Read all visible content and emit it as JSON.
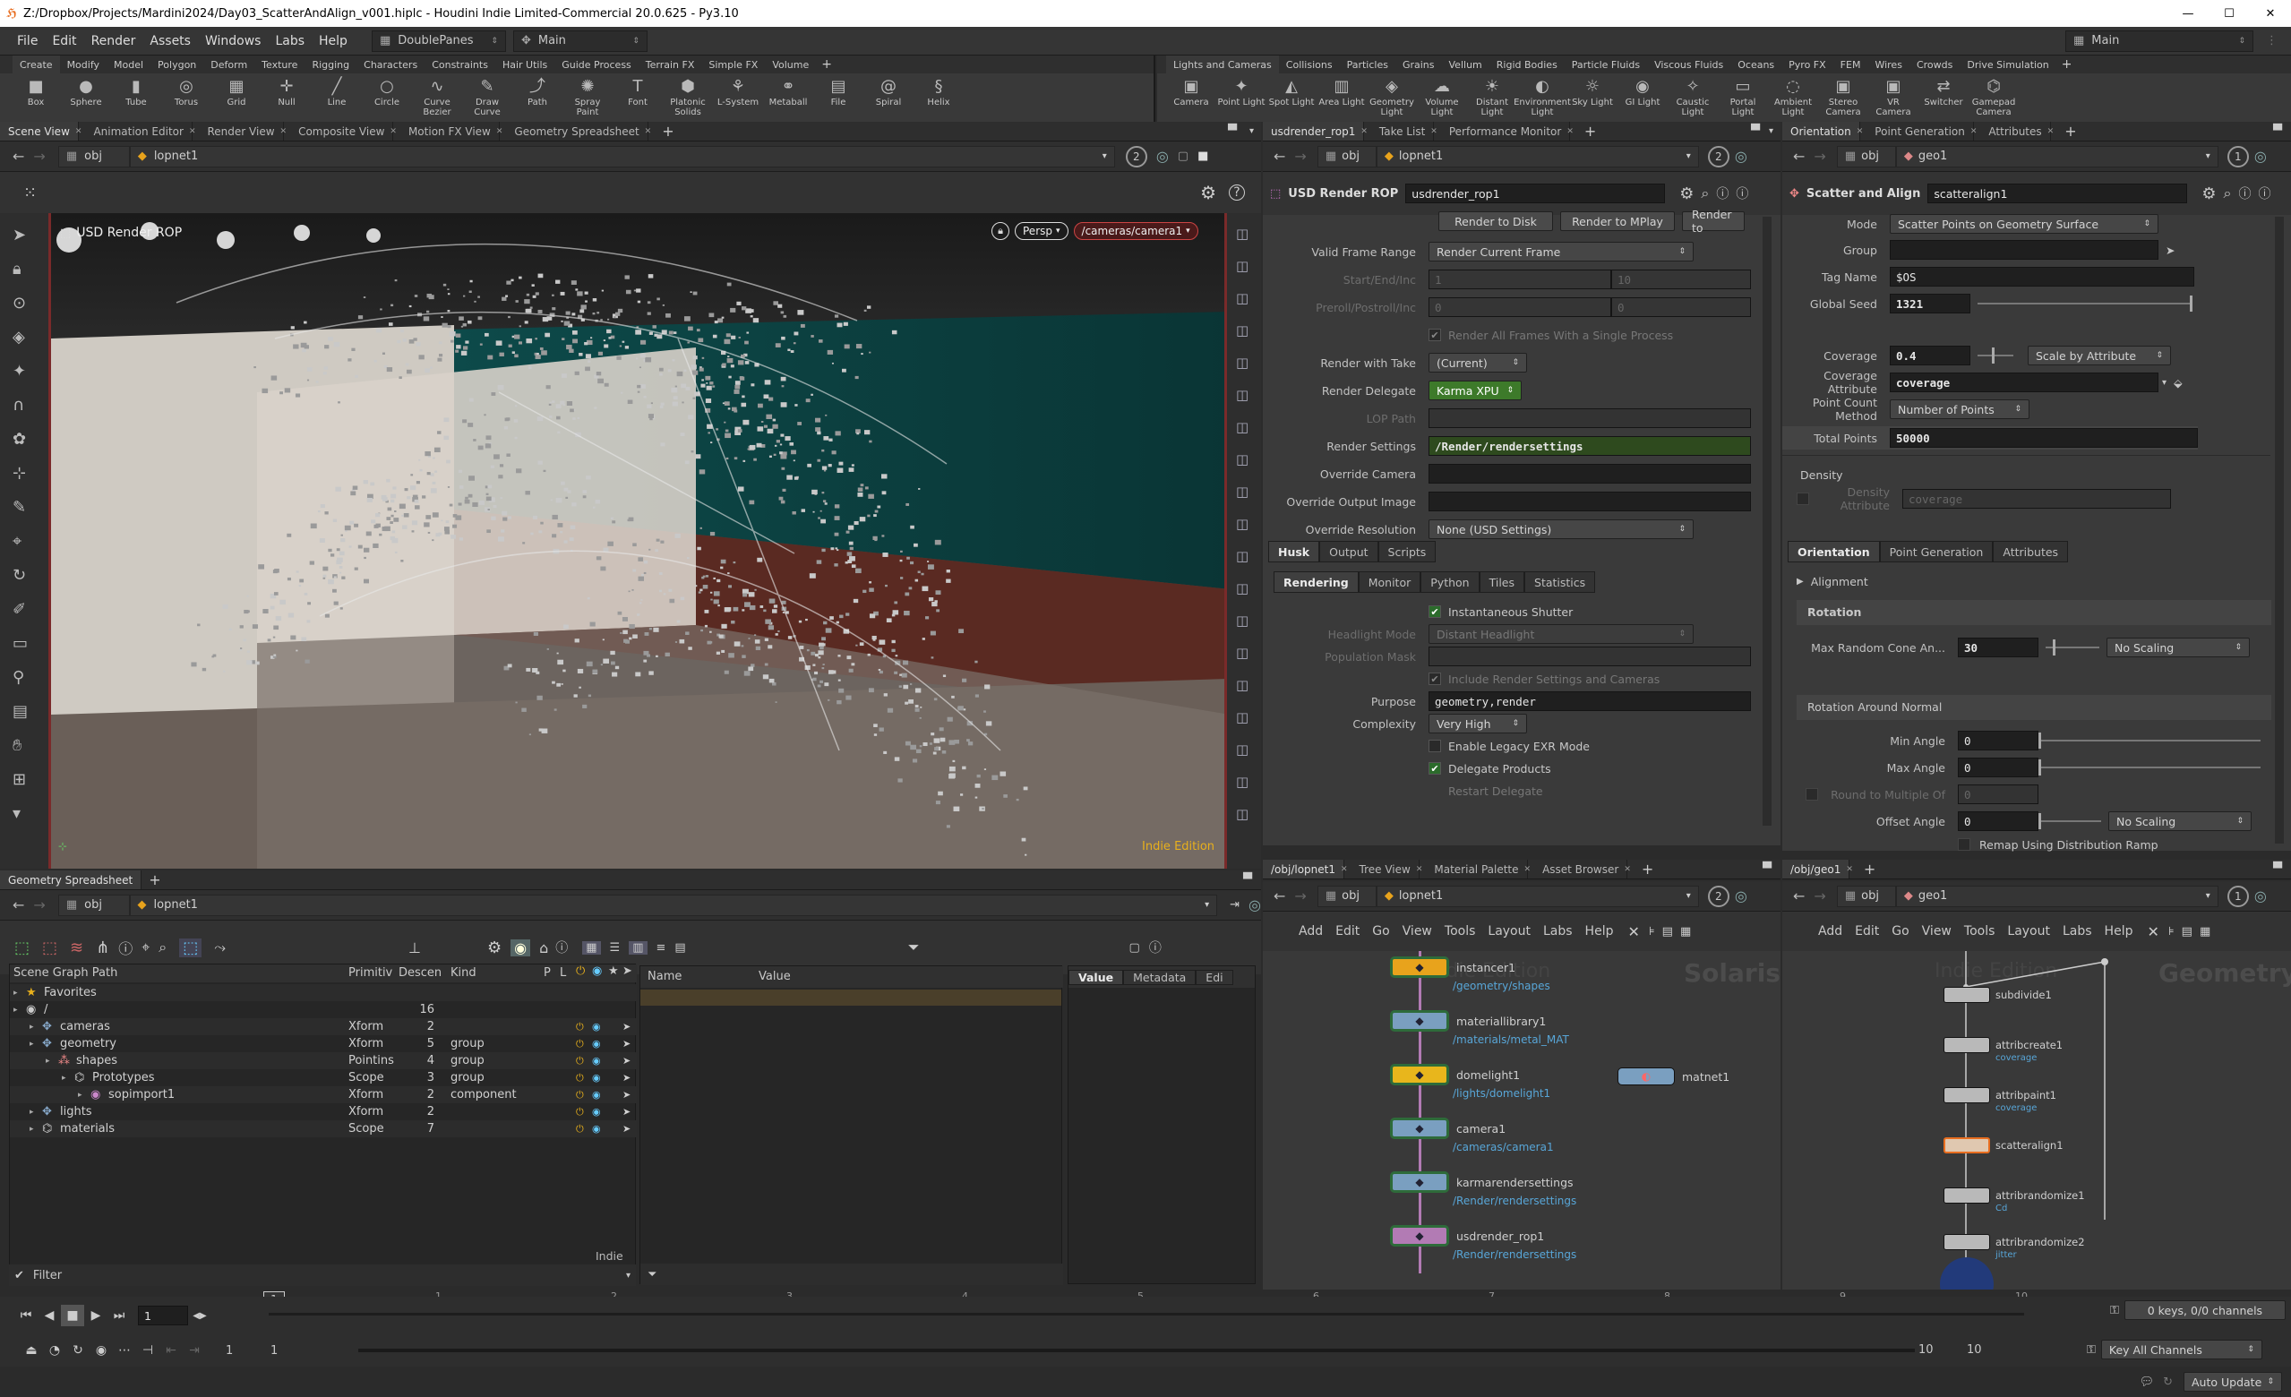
{
  "titlebar": {
    "title": "Z:/Dropbox/Projects/Mardini2024/Day03_ScatterAndAlign_v001.hiplc - Houdini Indie Limited-Commercial 20.0.625 - Py3.10",
    "minimize": "—",
    "maximize": "☐",
    "close": "✕"
  },
  "menubar": {
    "items": [
      "File",
      "Edit",
      "Render",
      "Assets",
      "Windows",
      "Labs",
      "Help"
    ],
    "desktop": "DoublePanes",
    "workspace": "Main",
    "right_workspace": "Main"
  },
  "shelf_left": {
    "tabs": [
      "Create",
      "Modify",
      "Model",
      "Polygon",
      "Deform",
      "Texture",
      "Rigging",
      "Characters",
      "Constraints",
      "Hair Utils",
      "Guide Process",
      "Terrain FX",
      "Simple FX",
      "Volume"
    ],
    "tools": [
      {
        "label": "Box",
        "icon": "box-icon",
        "glyph": "■"
      },
      {
        "label": "Sphere",
        "icon": "sphere-icon",
        "glyph": "●"
      },
      {
        "label": "Tube",
        "icon": "tube-icon",
        "glyph": "▮"
      },
      {
        "label": "Torus",
        "icon": "torus-icon",
        "glyph": "◎"
      },
      {
        "label": "Grid",
        "icon": "grid-icon",
        "glyph": "▦"
      },
      {
        "label": "Null",
        "icon": "null-icon",
        "glyph": "✛"
      },
      {
        "label": "Line",
        "icon": "line-icon",
        "glyph": "╱"
      },
      {
        "label": "Circle",
        "icon": "circle-icon",
        "glyph": "○"
      },
      {
        "label": "Curve Bezier",
        "icon": "curve-bezier-icon",
        "glyph": "∿"
      },
      {
        "label": "Draw Curve",
        "icon": "draw-curve-icon",
        "glyph": "✎"
      },
      {
        "label": "Path",
        "icon": "path-icon",
        "glyph": "⤴"
      },
      {
        "label": "Spray Paint",
        "icon": "spray-paint-icon",
        "glyph": "✺"
      },
      {
        "label": "Font",
        "icon": "font-icon",
        "glyph": "T"
      },
      {
        "label": "Platonic Solids",
        "icon": "platonic-solids-icon",
        "glyph": "⬢"
      },
      {
        "label": "L-System",
        "icon": "l-system-icon",
        "glyph": "⚘"
      },
      {
        "label": "Metaball",
        "icon": "metaball-icon",
        "glyph": "⚭"
      },
      {
        "label": "File",
        "icon": "file-icon",
        "glyph": "▤"
      },
      {
        "label": "Spiral",
        "icon": "spiral-icon",
        "glyph": "@"
      },
      {
        "label": "Helix",
        "icon": "helix-icon",
        "glyph": "§"
      }
    ]
  },
  "shelf_right": {
    "tabs": [
      "Lights and Cameras",
      "Collisions",
      "Particles",
      "Grains",
      "Vellum",
      "Rigid Bodies",
      "Particle Fluids",
      "Viscous Fluids",
      "Oceans",
      "Pyro FX",
      "FEM",
      "Wires",
      "Crowds",
      "Drive Simulation"
    ],
    "tools": [
      {
        "label": "Camera",
        "icon": "camera-icon",
        "glyph": "▣"
      },
      {
        "label": "Point Light",
        "icon": "point-light-icon",
        "glyph": "✦"
      },
      {
        "label": "Spot Light",
        "icon": "spot-light-icon",
        "glyph": "◭"
      },
      {
        "label": "Area Light",
        "icon": "area-light-icon",
        "glyph": "▥"
      },
      {
        "label": "Geometry Light",
        "icon": "geometry-light-icon",
        "glyph": "◈"
      },
      {
        "label": "Volume Light",
        "icon": "volume-light-icon",
        "glyph": "☁"
      },
      {
        "label": "Distant Light",
        "icon": "distant-light-icon",
        "glyph": "☀"
      },
      {
        "label": "Environment Light",
        "icon": "environment-light-icon",
        "glyph": "◐"
      },
      {
        "label": "Sky Light",
        "icon": "sky-light-icon",
        "glyph": "☼"
      },
      {
        "label": "GI Light",
        "icon": "gi-light-icon",
        "glyph": "◉"
      },
      {
        "label": "Caustic Light",
        "icon": "caustic-light-icon",
        "glyph": "✧"
      },
      {
        "label": "Portal Light",
        "icon": "portal-light-icon",
        "glyph": "▭"
      },
      {
        "label": "Ambient Light",
        "icon": "ambient-light-icon",
        "glyph": "◌"
      },
      {
        "label": "Stereo Camera",
        "icon": "stereo-camera-icon",
        "glyph": "▣"
      },
      {
        "label": "VR Camera",
        "icon": "vr-camera-icon",
        "glyph": "▣"
      },
      {
        "label": "Switcher",
        "icon": "switcher-icon",
        "glyph": "⇄"
      },
      {
        "label": "Gamepad Camera",
        "icon": "gamepad-camera-icon",
        "glyph": "⌬"
      }
    ]
  },
  "viewer": {
    "tabs": [
      "Scene View",
      "Animation Editor",
      "Render View",
      "Composite View",
      "Motion FX View",
      "Geometry Spreadsheet"
    ],
    "path": [
      "obj",
      "lopnet1"
    ],
    "badge": "2",
    "overlay_title": "USD Render ROP",
    "persp": "Persp",
    "camera": "/cameras/camera1",
    "watermark": "Indie Edition"
  },
  "rop_panel": {
    "tabs": [
      "usdrender_rop1",
      "Take List",
      "Performance Monitor"
    ],
    "path": [
      "obj",
      "lopnet1"
    ],
    "badge": "2",
    "node_type": "USD Render ROP",
    "node_name": "usdrender_rop1",
    "buttons": [
      "Render to Disk",
      "Render to MPlay",
      "Render to"
    ],
    "parms": [
      {
        "label": "Valid Frame Range",
        "value": "Render Current Frame",
        "kind": "menu"
      },
      {
        "label": "Start/End/Inc",
        "v1": "1",
        "v2": "10",
        "kind": "dim"
      },
      {
        "label": "Preroll/Postroll/Inc",
        "v1": "0",
        "v2": "0",
        "kind": "dim"
      },
      {
        "label": "",
        "value": "Render All Frames With a Single Process",
        "kind": "dimcheck"
      },
      {
        "label": "Render with Take",
        "value": "(Current)",
        "kind": "menu"
      },
      {
        "label": "Render Delegate",
        "value": "Karma XPU",
        "kind": "green"
      },
      {
        "label": "LOP Path",
        "value": "",
        "kind": "dimfield"
      },
      {
        "label": "Render Settings",
        "value": "/Render/rendersettings",
        "kind": "greenfield"
      },
      {
        "label": "Override Camera",
        "value": "",
        "kind": "field"
      },
      {
        "label": "Override Output Image",
        "value": "",
        "kind": "field"
      },
      {
        "label": "Override Resolution",
        "value": "None (USD Settings)",
        "kind": "menu"
      }
    ],
    "tabs1": [
      "Husk",
      "Output",
      "Scripts"
    ],
    "tabs2": [
      "Rendering",
      "Monitor",
      "Python",
      "Tiles",
      "Statistics"
    ],
    "rendering": [
      {
        "label": "",
        "value": "Instantaneous Shutter",
        "kind": "check"
      },
      {
        "label": "Headlight Mode",
        "value": "Distant Headlight",
        "kind": "dimmenu"
      },
      {
        "label": "Population Mask",
        "value": "",
        "kind": "dimfield"
      },
      {
        "label": "",
        "value": "Include Render Settings and Cameras",
        "kind": "dimcheck"
      },
      {
        "label": "Purpose",
        "value": "geometry,render",
        "kind": "field"
      },
      {
        "label": "Complexity",
        "value": "Very High",
        "kind": "menu"
      },
      {
        "label": "",
        "value": "Enable Legacy EXR Mode",
        "kind": "uncheck"
      },
      {
        "label": "",
        "value": "Delegate Products",
        "kind": "check"
      },
      {
        "label": "",
        "value": "Restart Delegate",
        "kind": "dimtext"
      }
    ]
  },
  "scatter_panel": {
    "tabs": [
      "Orientation",
      "Point Generation",
      "Attributes"
    ],
    "path": [
      "obj",
      "geo1"
    ],
    "badge": "1",
    "node_type": "Scatter and Align",
    "node_name": "scatteralign1",
    "mode": {
      "label": "Mode",
      "value": "Scatter Points on Geometry Surface"
    },
    "group": {
      "label": "Group",
      "value": ""
    },
    "tag": {
      "label": "Tag Name",
      "value": "$OS"
    },
    "seed": {
      "label": "Global Seed",
      "value": "1321"
    },
    "coverage": {
      "label": "Coverage",
      "value": "0.4",
      "button": "Scale by Attribute"
    },
    "cov_attr": {
      "label": "Coverage Attribute",
      "value": "coverage"
    },
    "pcm": {
      "label": "Point Count Method",
      "value": "Number of Points"
    },
    "total": {
      "label": "Total Points",
      "value": "50000"
    },
    "density": "Density",
    "density_attr": {
      "label": "Density Attribute",
      "value": "coverage"
    },
    "alignment": "Alignment",
    "rotation": "Rotation",
    "max_cone": {
      "label": "Max Random Cone An...",
      "value": "30",
      "menu": "No Scaling"
    },
    "ran": "Rotation Around Normal",
    "min_angle": {
      "label": "Min Angle",
      "value": "0"
    },
    "max_angle": {
      "label": "Max Angle",
      "value": "0"
    },
    "round": {
      "label": "Round to Multiple Of",
      "value": "0"
    },
    "offset": {
      "label": "Offset Angle",
      "value": "0",
      "menu": "No Scaling"
    },
    "remap": "Remap Using Distribution Ramp"
  },
  "spreadsheet": {
    "tab": "Geometry Spreadsheet",
    "path": [
      "obj",
      "lopnet1"
    ],
    "headers": [
      "Scene Graph Path",
      "Primitiv",
      "Descen",
      "Kind",
      "P",
      "L"
    ],
    "rows": [
      {
        "name": "Favorites",
        "type": "",
        "desc": "",
        "kind": "",
        "indent": 0,
        "icon": "star-icon"
      },
      {
        "name": "/",
        "type": "",
        "desc": "16",
        "kind": "",
        "indent": 0,
        "icon": "root-icon"
      },
      {
        "name": "cameras",
        "type": "Xform",
        "desc": "2",
        "kind": "",
        "indent": 1,
        "icon": "xform-icon"
      },
      {
        "name": "geometry",
        "type": "Xform",
        "desc": "5",
        "kind": "group",
        "indent": 1,
        "icon": "xform-icon"
      },
      {
        "name": "shapes",
        "type": "Pointins",
        "desc": "4",
        "kind": "group",
        "indent": 2,
        "icon": "pointinstancer-icon"
      },
      {
        "name": "Prototypes",
        "type": "Scope",
        "desc": "3",
        "kind": "group",
        "indent": 3,
        "icon": "scope-icon"
      },
      {
        "name": "sopimport1",
        "type": "Xform",
        "desc": "2",
        "kind": "component",
        "indent": 4,
        "icon": "sop-icon"
      },
      {
        "name": "lights",
        "type": "Xform",
        "desc": "2",
        "kind": "",
        "indent": 1,
        "icon": "xform-icon"
      },
      {
        "name": "materials",
        "type": "Scope",
        "desc": "7",
        "kind": "",
        "indent": 1,
        "icon": "scope-icon"
      }
    ],
    "attr_headers": [
      "Name",
      "Value"
    ],
    "side_tabs": [
      "Value",
      "Metadata",
      "Edi"
    ],
    "indie": "Indie",
    "filter": "Filter"
  },
  "network_left": {
    "tabs": [
      "/obj/lopnet1",
      "Tree View",
      "Material Palette",
      "Asset Browser"
    ],
    "path": [
      "obj",
      "lopnet1"
    ],
    "badge": "2",
    "menu": [
      "Add",
      "Edit",
      "Go",
      "View",
      "Tools",
      "Layout",
      "Labs",
      "Help"
    ],
    "context": "Solaris",
    "watermark": "Indie Edition",
    "nodes": [
      {
        "name": "instancer1",
        "path": "/geometry/shapes",
        "color": "#e8a31c"
      },
      {
        "name": "materiallibrary1",
        "path": "/materials/metal_MAT",
        "color": "#7a9fc0"
      },
      {
        "name": "domelight1",
        "path": "/lights/domelight1",
        "color": "#e8b61c"
      },
      {
        "name": "camera1",
        "path": "/cameras/camera1",
        "color": "#7a9fc0"
      },
      {
        "name": "karmarendersettings",
        "path": "/Render/rendersettings",
        "color": "#7a9fc0"
      },
      {
        "name": "usdrender_rop1",
        "path": "/Render/rendersettings",
        "color": "#b27bb4"
      }
    ],
    "matnet": "matnet1"
  },
  "network_right": {
    "tabs": [
      "/obj/geo1"
    ],
    "path": [
      "obj",
      "geo1"
    ],
    "badge": "1",
    "menu": [
      "Add",
      "Edit",
      "Go",
      "View",
      "Tools",
      "Layout",
      "Labs",
      "Help"
    ],
    "context": "Geometry",
    "watermark": "Indie Edition",
    "nodes": [
      {
        "name": "subdivide1",
        "sub": ""
      },
      {
        "name": "attribcreate1",
        "sub": "coverage"
      },
      {
        "name": "attribpaint1",
        "sub": "coverage"
      },
      {
        "name": "scatteralign1",
        "sub": ""
      },
      {
        "name": "attribrandomize1",
        "sub": "Cd"
      },
      {
        "name": "attribrandomize2",
        "sub": "jitter"
      }
    ]
  },
  "timeline": {
    "ticks": [
      "1",
      "2",
      "3",
      "4",
      "5",
      "6",
      "7",
      "8",
      "9",
      "10"
    ],
    "current": "1",
    "frame": "1",
    "start": "1",
    "start2": "1",
    "end": "10",
    "end2": "10",
    "keys": "0 keys, 0/0 channels",
    "key_all": "Key All Channels",
    "auto_update": "Auto Update"
  }
}
